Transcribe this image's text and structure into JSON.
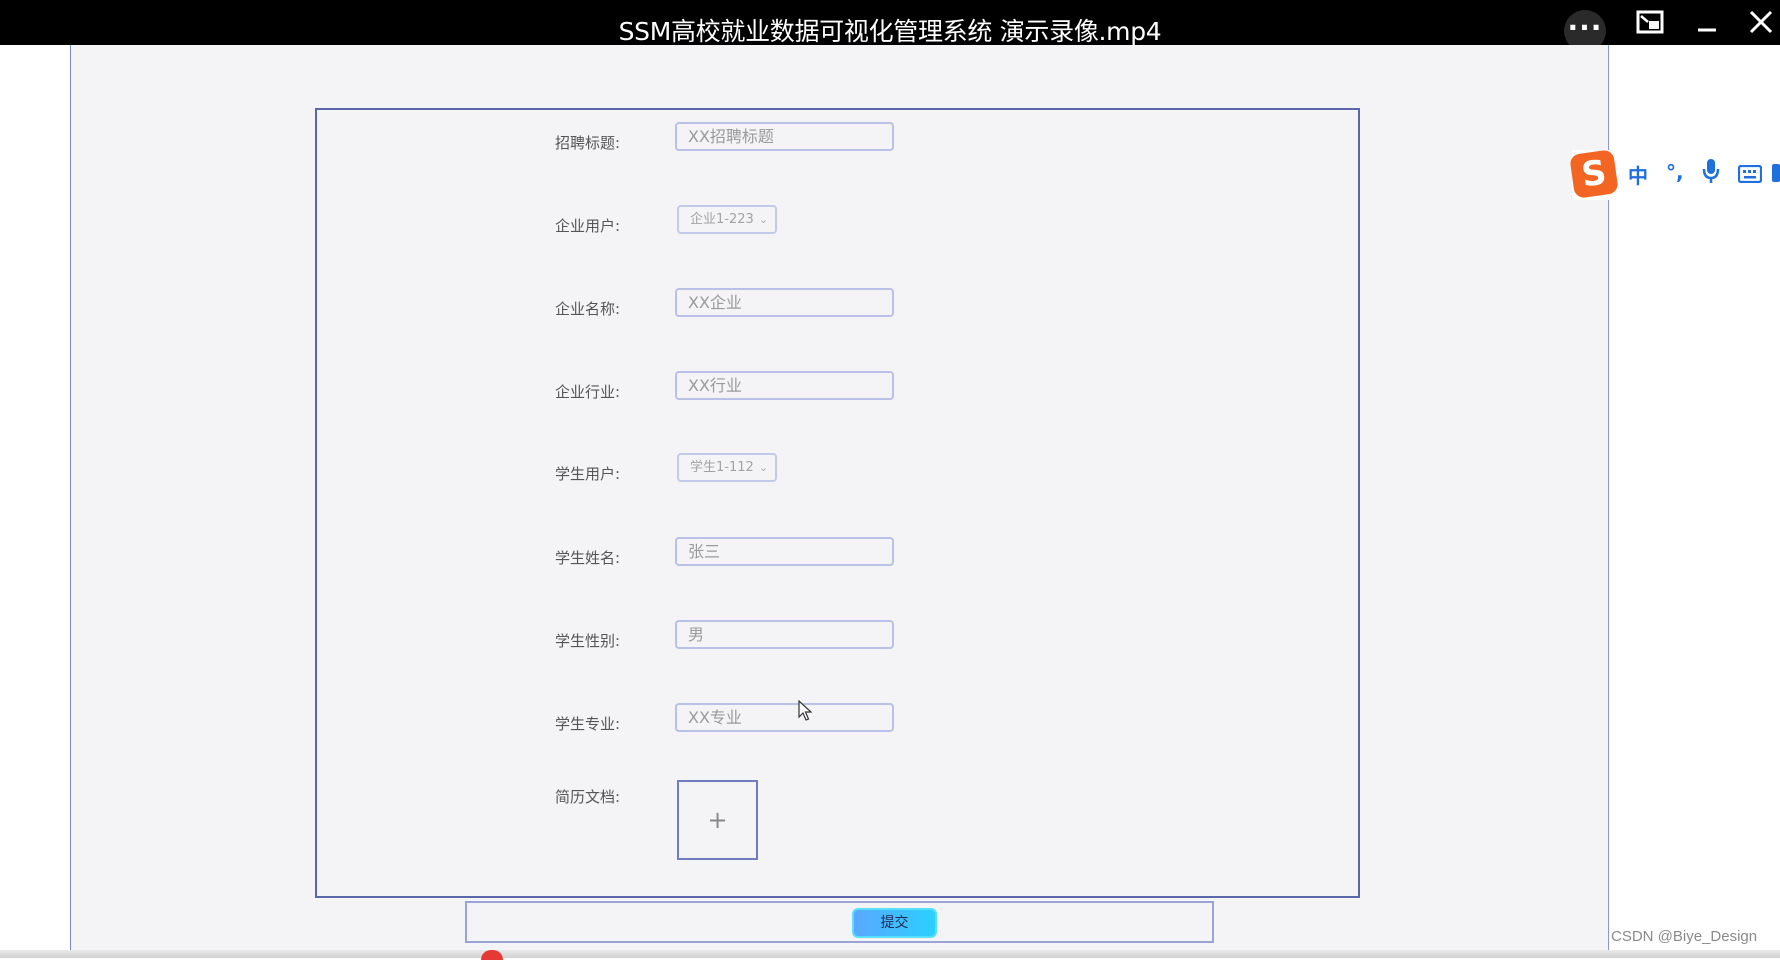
{
  "window": {
    "title": "SSM高校就业数据可视化管理系统 演示录像.mp4",
    "more_icon": "more-dots-icon",
    "pip_icon": "picture-in-picture-icon",
    "minimize_icon": "minimize-icon",
    "close_icon": "close-icon"
  },
  "form": {
    "fields": [
      {
        "label": "招聘标题:",
        "type": "input",
        "value": "XX招聘标题"
      },
      {
        "label": "企业用户:",
        "type": "select",
        "value": "企业1-223"
      },
      {
        "label": "企业名称:",
        "type": "input",
        "value": "XX企业"
      },
      {
        "label": "企业行业:",
        "type": "input",
        "value": "XX行业"
      },
      {
        "label": "学生用户:",
        "type": "select",
        "value": "学生1-112"
      },
      {
        "label": "学生姓名:",
        "type": "input",
        "value": "张三"
      },
      {
        "label": "学生性别:",
        "type": "input",
        "value": "男"
      },
      {
        "label": "学生专业:",
        "type": "input",
        "value": "XX专业"
      },
      {
        "label": "简历文档:",
        "type": "upload",
        "value": "+"
      }
    ],
    "submit_label": "提交"
  },
  "ime": {
    "logo": "S",
    "mode": "中",
    "punct": "°,",
    "mic_icon": "microphone-icon",
    "keyboard_icon": "keyboard-icon"
  },
  "watermark": "CSDN @Biye_Design"
}
